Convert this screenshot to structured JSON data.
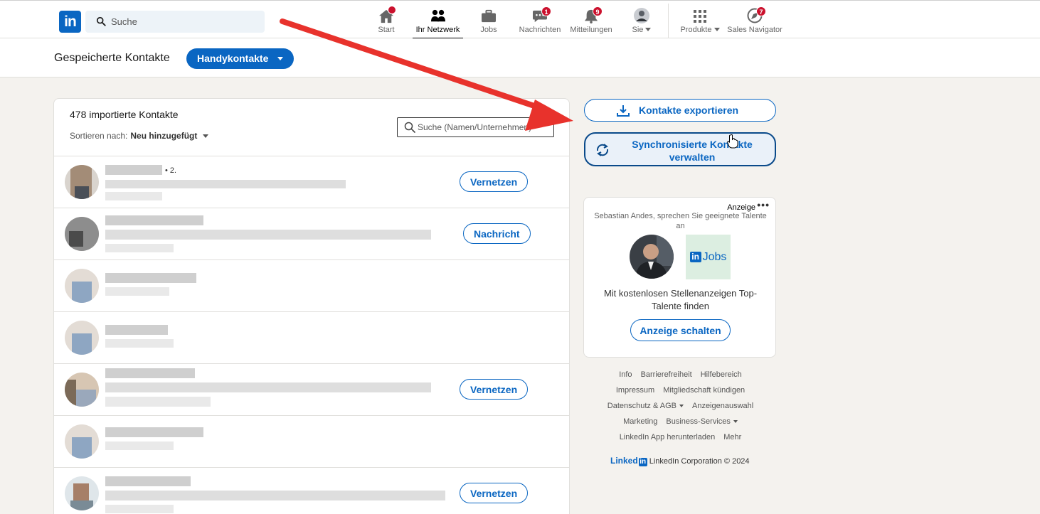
{
  "nav": {
    "logo": "in",
    "search_placeholder": "Suche",
    "items": [
      {
        "label": "Start",
        "badge": ""
      },
      {
        "label": "Ihr Netzwerk",
        "badge": ""
      },
      {
        "label": "Jobs",
        "badge": ""
      },
      {
        "label": "Nachrichten",
        "badge": "1"
      },
      {
        "label": "Mitteilungen",
        "badge": "9"
      },
      {
        "label": "Sie",
        "badge": ""
      },
      {
        "label": "Produkte",
        "badge": ""
      },
      {
        "label": "Sales Navigator",
        "badge": "7"
      }
    ]
  },
  "subheader": {
    "title": "Gespeicherte Kontakte",
    "dropdown": "Handykontakte"
  },
  "contacts": {
    "count_text": "478 importierte Kontakte",
    "sort_label": "Sortieren nach:",
    "sort_value": "Neu hinzugefügt",
    "search_placeholder": "Suche (Namen/Unternehmen)",
    "rows": [
      {
        "degree": "• 2.",
        "action": "Vernetzen"
      },
      {
        "degree": "",
        "action": "Nachricht"
      },
      {
        "degree": "",
        "action": ""
      },
      {
        "degree": "",
        "action": ""
      },
      {
        "degree": "",
        "action": "Vernetzen"
      },
      {
        "degree": "",
        "action": ""
      },
      {
        "degree": "",
        "action": "Vernetzen"
      }
    ]
  },
  "sidebar": {
    "export_label": "Kontakte exportieren",
    "sync_label": "Synchronisierte Kontakte verwalten"
  },
  "ad": {
    "tag": "Anzeige",
    "dots": "•••",
    "pitch": "Sebastian Andes, sprechen Sie geeignete Talente an",
    "jobs_logo_in": "in",
    "jobs_logo_text": "Jobs",
    "message": "Mit kostenlosen Stellenanzeigen Top-Talente finden",
    "cta": "Anzeige schalten"
  },
  "footer": {
    "links": [
      "Info",
      "Barrierefreiheit",
      "Hilfebereich",
      "Impressum",
      "Mitgliedschaft kündigen",
      "Datenschutz & AGB",
      "Anzeigenauswahl",
      "Marketing",
      "Business-Services",
      "LinkedIn App herunterladen",
      "Mehr"
    ],
    "brand_text": "Linked",
    "brand_in": "in",
    "copyright": "LinkedIn Corporation © 2024"
  },
  "colors": {
    "brand": "#0a66c2",
    "badge": "#cb112d",
    "annotation_arrow": "#e8322c"
  }
}
